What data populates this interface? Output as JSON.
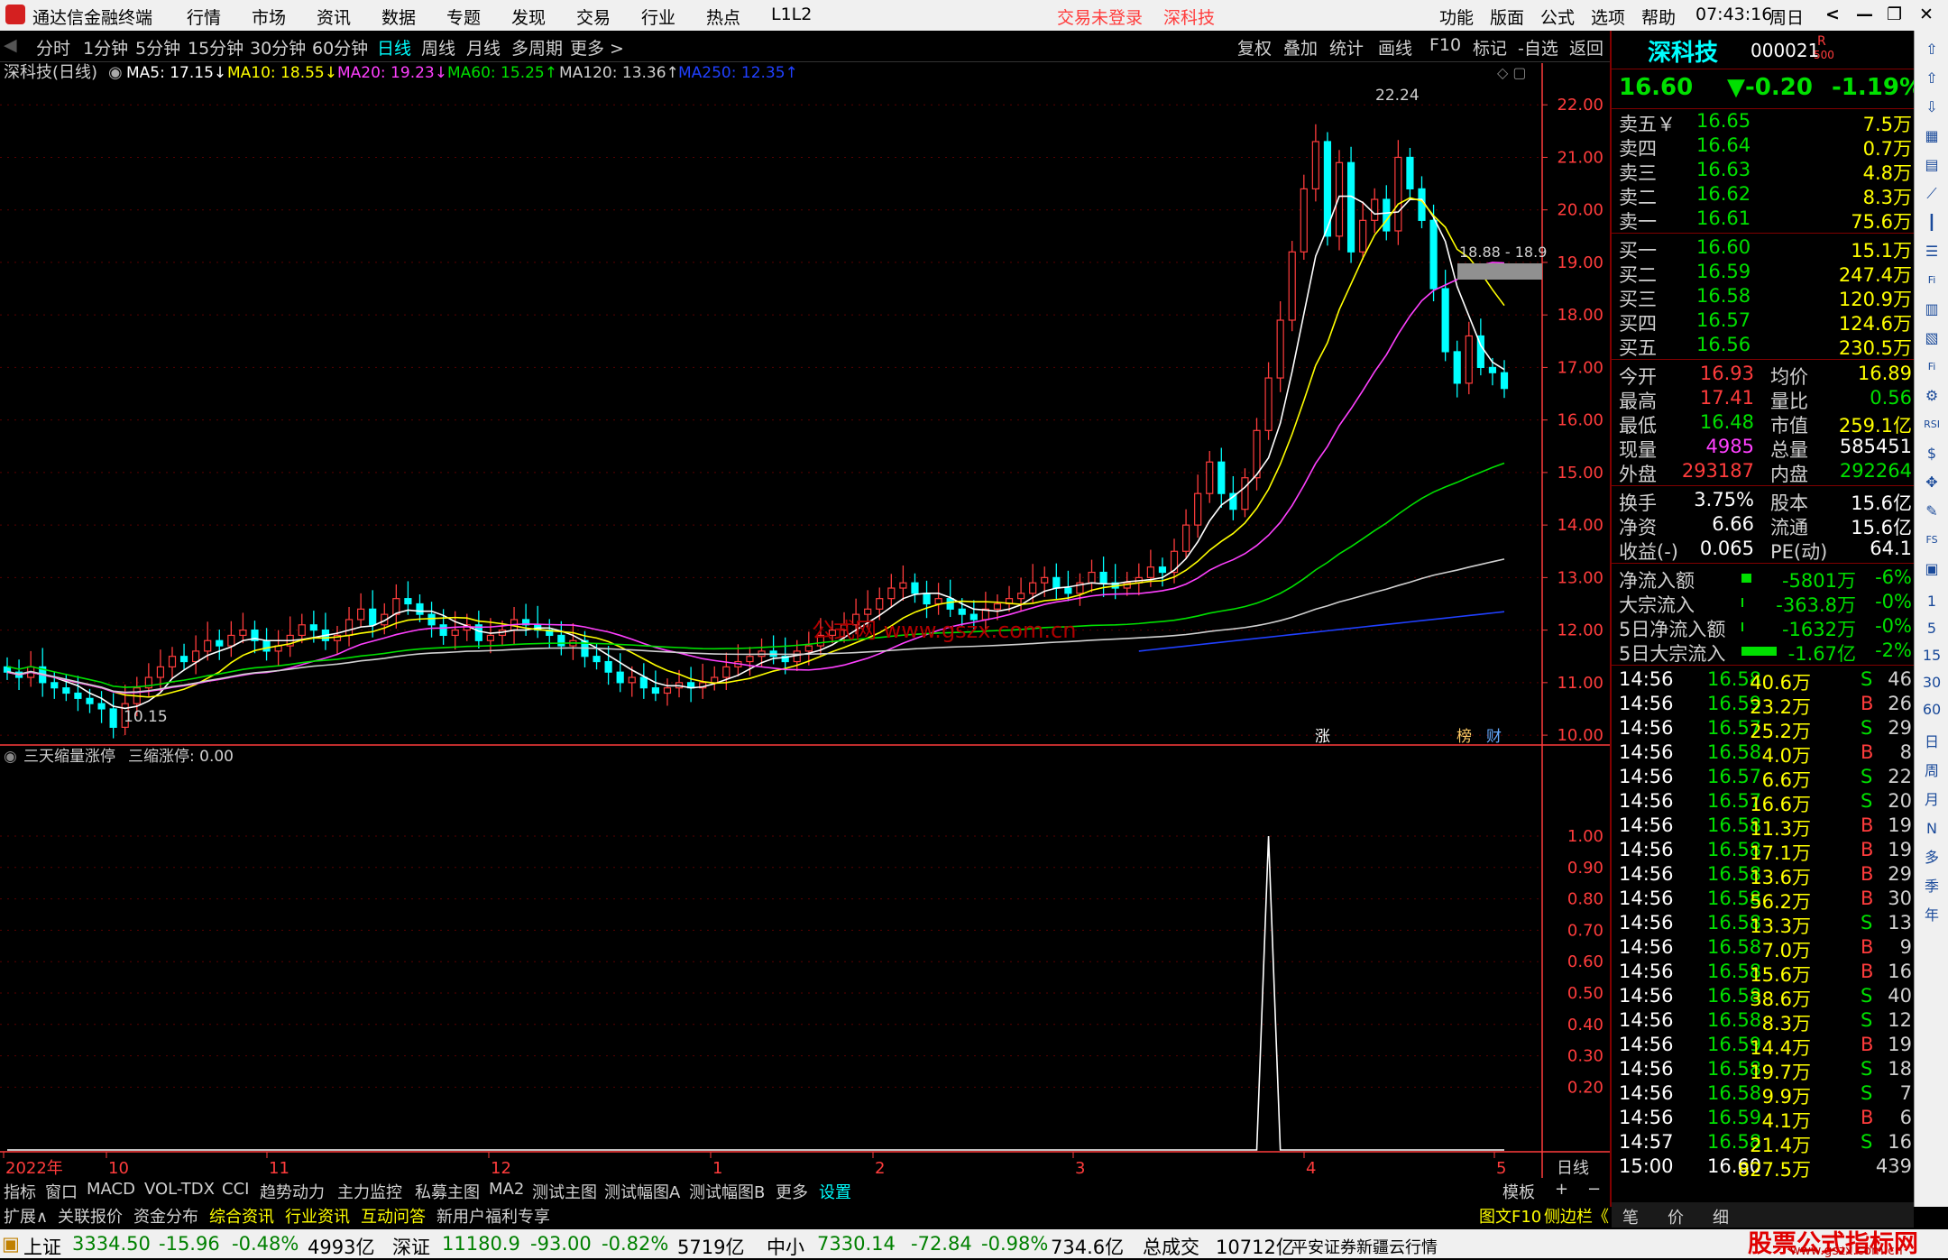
{
  "titlebar": {
    "app": "通达信金融终端",
    "menus": [
      "行情",
      "市场",
      "资讯",
      "数据",
      "专题",
      "发现",
      "交易",
      "行业",
      "热点",
      "L1L2"
    ],
    "login": "交易未登录",
    "stock": "深科技",
    "right_menus": [
      "功能",
      "版面",
      "公式",
      "选项",
      "帮助"
    ],
    "time": "07:43:16",
    "weekday": "周日"
  },
  "periodbar": {
    "periods": [
      "分时",
      "1分钟",
      "5分钟",
      "15分钟",
      "30分钟",
      "60分钟",
      "日线",
      "周线",
      "月线",
      "多周期",
      "更多 >"
    ],
    "active": "日线",
    "tools": [
      "复权",
      "叠加",
      "统计",
      "画线",
      "F10",
      "标记",
      "-自选",
      "返回"
    ]
  },
  "chart_header": {
    "name": "深科技(日线)",
    "ma5": "MA5: 17.15↓",
    "ma10": "MA10: 18.55↓",
    "ma20": "MA20: 19.23↓",
    "ma60": "MA60: 15.25↑",
    "ma120": "MA120: 13.36↑",
    "ma250": "MA250: 12.35↑"
  },
  "chart_labels": {
    "high": "22.24",
    "low": "10.15",
    "band": "18.88 - 18.9",
    "watermark": "公式网 www.gszx.com.cn",
    "flags": [
      "涨",
      "榜",
      "财"
    ]
  },
  "indicator_header": {
    "name": "三天缩量涨停",
    "value": "三缩涨停: 0.00"
  },
  "colors": {
    "up": "#ff3c3c",
    "down": "#00ffff",
    "ma5": "#ffffff",
    "ma10": "#ffff00",
    "ma20": "#ff40ff",
    "ma60": "#00e000",
    "ma120": "#d0d0d0",
    "ma250": "#2040ff",
    "grid": "#5a0000",
    "axis": "#ff3c3c"
  },
  "chart_data": [
    {
      "type": "candlestick",
      "title": "深科技(日线)",
      "y_ticks": [
        "22.00",
        "21.00",
        "20.00",
        "19.00",
        "18.00",
        "17.00",
        "16.00",
        "15.00",
        "14.00",
        "13.00",
        "12.00",
        "11.00",
        "10.00"
      ],
      "ylim": [
        9.95,
        22.45
      ],
      "x_ticks": [
        "2022年",
        "10",
        "11",
        "12",
        "1",
        "2",
        "3",
        "4",
        "5"
      ],
      "closes": [
        11.2,
        11.1,
        11.3,
        11.0,
        10.9,
        10.8,
        10.7,
        10.6,
        10.5,
        10.15,
        10.6,
        10.9,
        11.1,
        11.3,
        11.5,
        11.4,
        11.6,
        11.8,
        11.7,
        11.9,
        12.0,
        11.8,
        11.6,
        11.7,
        11.9,
        12.1,
        12.0,
        11.8,
        11.9,
        12.2,
        12.4,
        12.1,
        12.3,
        12.6,
        12.5,
        12.3,
        12.1,
        11.9,
        12.0,
        12.1,
        11.8,
        11.9,
        12.0,
        12.2,
        12.1,
        12.0,
        11.9,
        11.7,
        11.8,
        11.5,
        11.4,
        11.2,
        11.0,
        11.1,
        10.9,
        10.8,
        10.9,
        11.0,
        10.9,
        11.0,
        11.1,
        11.3,
        11.4,
        11.5,
        11.6,
        11.5,
        11.4,
        11.6,
        11.7,
        11.9,
        12.0,
        12.1,
        12.3,
        12.4,
        12.6,
        12.8,
        12.9,
        12.7,
        12.5,
        12.6,
        12.4,
        12.3,
        12.2,
        12.4,
        12.5,
        12.6,
        12.7,
        12.9,
        13.0,
        12.8,
        12.7,
        12.9,
        13.1,
        12.9,
        12.8,
        12.9,
        13.0,
        13.2,
        13.1,
        13.5,
        14.0,
        14.6,
        15.2,
        14.6,
        14.3,
        14.9,
        15.8,
        16.8,
        17.9,
        19.2,
        20.4,
        21.3,
        19.5,
        20.9,
        19.2,
        19.8,
        20.2,
        19.6,
        21.0,
        20.4,
        19.8,
        18.5,
        17.3,
        16.7,
        17.6,
        17.0,
        16.9,
        16.6
      ],
      "ma5_last": 17.15,
      "ma10_last": 18.55,
      "ma20_last": 19.23,
      "ma60_last": 15.25,
      "ma120_last": 13.36,
      "ma250_last": 12.35
    },
    {
      "type": "line",
      "title": "三天缩量涨停",
      "y_ticks": [
        "1.00",
        "0.90",
        "0.80",
        "0.70",
        "0.60",
        "0.50",
        "0.40",
        "0.30",
        "0.20"
      ],
      "ylim": [
        0,
        1.0
      ],
      "series": [
        {
          "name": "三缩涨停",
          "spike_at_index": 107,
          "spike_value": 1.0,
          "other_value": 0.0
        }
      ]
    }
  ],
  "quote": {
    "name": "深科技",
    "code": "000021",
    "code_mark": "R",
    "code_sub": "500",
    "price": "16.60",
    "change": "▼-0.20",
    "pct": "-1.19%",
    "asks": [
      {
        "label": "卖五￥",
        "price": "16.65",
        "vol": "7.5万"
      },
      {
        "label": "卖四",
        "price": "16.64",
        "vol": "0.7万"
      },
      {
        "label": "卖三",
        "price": "16.63",
        "vol": "4.8万"
      },
      {
        "label": "卖二",
        "price": "16.62",
        "vol": "8.3万"
      },
      {
        "label": "卖一",
        "price": "16.61",
        "vol": "75.6万"
      }
    ],
    "bids": [
      {
        "label": "买一",
        "price": "16.60",
        "vol": "15.1万"
      },
      {
        "label": "买二",
        "price": "16.59",
        "vol": "247.4万"
      },
      {
        "label": "买三",
        "price": "16.58",
        "vol": "120.9万"
      },
      {
        "label": "买四",
        "price": "16.57",
        "vol": "124.6万"
      },
      {
        "label": "买五",
        "price": "16.56",
        "vol": "230.5万"
      }
    ],
    "stats": [
      {
        "l1": "今开",
        "v1": "16.93",
        "l2": "均价",
        "v2": "16.89"
      },
      {
        "l1": "最高",
        "v1": "17.41",
        "l2": "量比",
        "v2": "0.56"
      },
      {
        "l1": "最低",
        "v1": "16.48",
        "l2": "市值",
        "v2": "259.1亿"
      },
      {
        "l1": "现量",
        "v1": "4985",
        "l2": "总量",
        "v2": "585451"
      },
      {
        "l1": "外盘",
        "v1": "293187",
        "l2": "内盘",
        "v2": "292264"
      }
    ],
    "stats2": [
      {
        "l1": "换手",
        "v1": "3.75%",
        "l2": "股本",
        "v2": "15.6亿"
      },
      {
        "l1": "净资",
        "v1": "6.66",
        "l2": "流通",
        "v2": "15.6亿"
      },
      {
        "l1": "收益(-)",
        "v1": "0.065",
        "l2": "PE(动)",
        "v2": "64.1"
      }
    ],
    "flows": [
      {
        "label": "净流入额",
        "value": "-5801万",
        "pct": "-6%",
        "bar": 0.1
      },
      {
        "label": "大宗流入",
        "value": "-363.8万",
        "pct": "-0%",
        "bar": 0.02
      },
      {
        "label": "5日净流入额",
        "value": "-1632万",
        "pct": "-0%",
        "bar": 0.02
      },
      {
        "label": "5日大宗流入",
        "value": "-1.67亿",
        "pct": "-2%",
        "bar": 0.35
      }
    ],
    "ticks": [
      [
        "14:56",
        "16.58",
        "40.6万",
        "S",
        "46"
      ],
      [
        "14:56",
        "16.59",
        "23.2万",
        "B",
        "26"
      ],
      [
        "14:56",
        "16.57",
        "25.2万",
        "S",
        "29"
      ],
      [
        "14:56",
        "16.58",
        "4.0万",
        "B",
        "8"
      ],
      [
        "14:56",
        "16.57",
        "6.6万",
        "S",
        "22"
      ],
      [
        "14:56",
        "16.57",
        "16.6万",
        "S",
        "20"
      ],
      [
        "14:56",
        "16.58",
        "11.3万",
        "B",
        "19"
      ],
      [
        "14:56",
        "16.58",
        "17.1万",
        "B",
        "19"
      ],
      [
        "14:56",
        "16.58",
        "13.6万",
        "B",
        "29"
      ],
      [
        "14:56",
        "16.58",
        "56.2万",
        "B",
        "30"
      ],
      [
        "14:56",
        "16.58",
        "13.3万",
        "S",
        "13"
      ],
      [
        "14:56",
        "16.58",
        "7.0万",
        "B",
        "9"
      ],
      [
        "14:56",
        "16.58",
        "15.6万",
        "B",
        "16"
      ],
      [
        "14:56",
        "16.58",
        "38.6万",
        "S",
        "40"
      ],
      [
        "14:56",
        "16.58",
        "8.3万",
        "S",
        "12"
      ],
      [
        "14:56",
        "16.59",
        "14.4万",
        "B",
        "19"
      ],
      [
        "14:56",
        "16.58",
        "19.7万",
        "S",
        "18"
      ],
      [
        "14:56",
        "16.58",
        "9.9万",
        "S",
        "7"
      ],
      [
        "14:56",
        "16.59",
        "4.1万",
        "B",
        "6"
      ],
      [
        "14:57",
        "16.58",
        "21.4万",
        "S",
        "16"
      ],
      [
        "15:00",
        "16.60",
        "827.5万",
        "",
        "439"
      ]
    ]
  },
  "rtool_labels": [
    "日",
    "周",
    "月",
    "N",
    "多",
    "季",
    "年"
  ],
  "rtool_numbers": [
    "1",
    "5",
    "15",
    "30",
    "60"
  ],
  "tabs1": [
    "指标",
    "窗口",
    "MACD",
    "VOL-TDX",
    "CCI",
    "趋势动力",
    "主力监控",
    "私募主图",
    "MA2",
    "测试主图",
    "测试幅图A",
    "测试幅图B",
    "更多",
    "设置"
  ],
  "tabs1_right": [
    "模板",
    "+",
    "−"
  ],
  "tabs2": [
    "扩展∧",
    "关联报价",
    "资金分布",
    "综合资讯",
    "行业资讯",
    "互动问答",
    "新用户福利专享"
  ],
  "tabs2_right": [
    "图文F10",
    "侧边栏《"
  ],
  "tabs2_side": [
    "笔",
    "价",
    "细"
  ],
  "period_label": "日线",
  "status": {
    "sh_label": "上证",
    "sh": "3334.50",
    "sh_chg": "-15.96",
    "sh_pct": "-0.48%",
    "sh_amt": "4993亿",
    "sz_label": "深证",
    "sz": "11180.9",
    "sz_chg": "-93.00",
    "sz_pct": "-0.82%",
    "sz_amt": "5719亿",
    "zx_label": "中小",
    "zx": "7330.14",
    "zx_chg": "-72.84",
    "zx_pct": "-0.98%",
    "zx_amt": "734.6亿",
    "total_label": "总成交",
    "total": "10712亿",
    "broker": "平安证券新疆云行情",
    "brand": "股票公式指标网",
    "brand_url": "www.gszx.com.cn"
  }
}
